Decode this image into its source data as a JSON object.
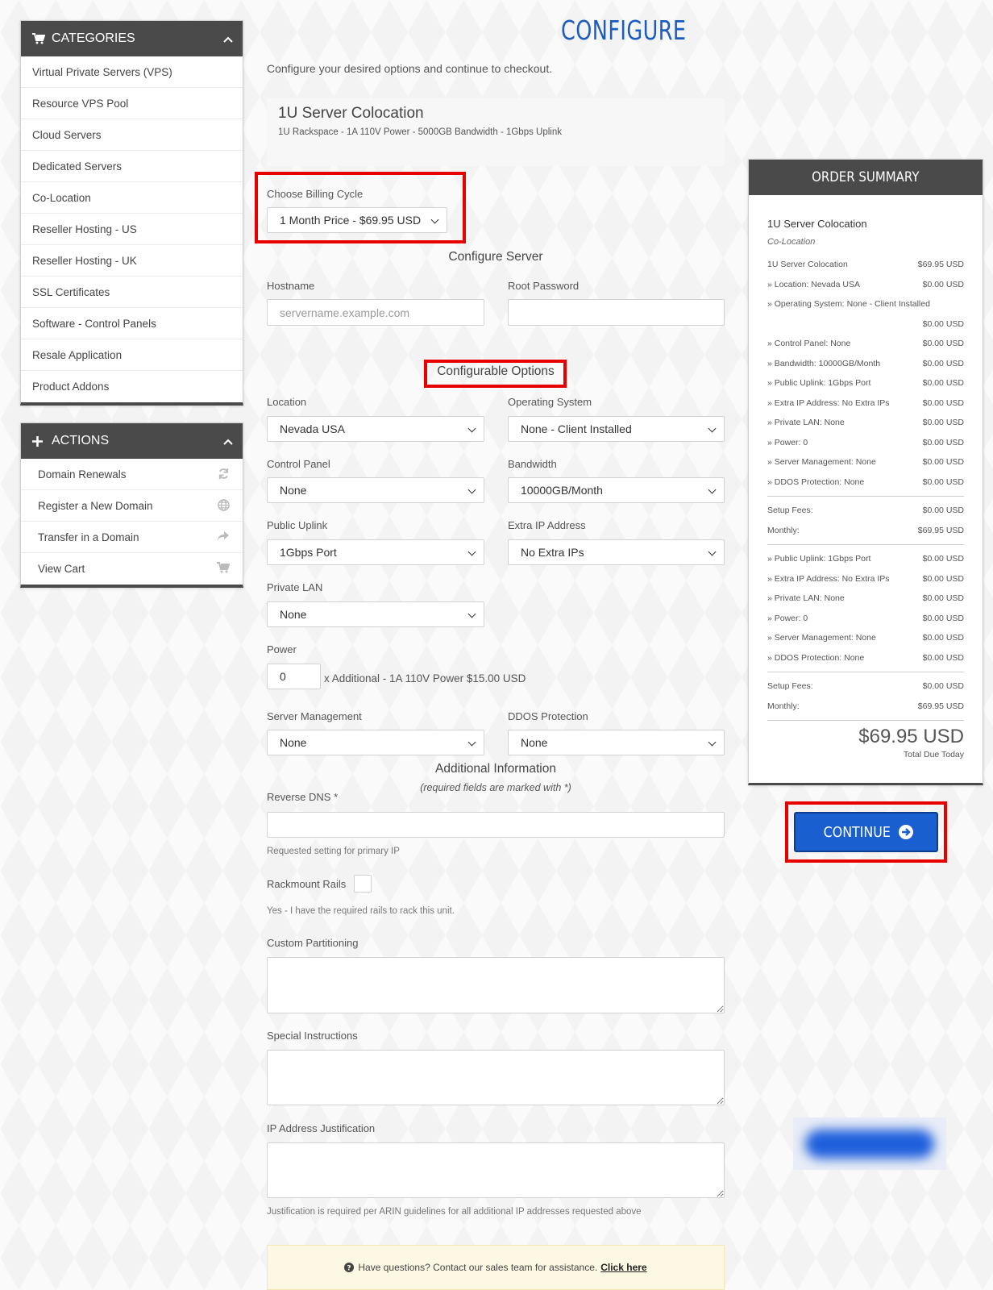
{
  "sidebar": {
    "categories_title": "CATEGORIES",
    "categories": [
      "Virtual Private Servers (VPS)",
      "Resource VPS Pool",
      "Cloud Servers",
      "Dedicated Servers",
      "Co-Location",
      "Reseller Hosting - US",
      "Reseller Hosting - UK",
      "SSL Certificates",
      "Software - Control Panels",
      "Resale Application",
      "Product Addons"
    ],
    "actions_title": "ACTIONS",
    "actions": [
      {
        "label": "Domain Renewals",
        "icon": "refresh-icon"
      },
      {
        "label": "Register a New Domain",
        "icon": "globe-icon"
      },
      {
        "label": "Transfer in a Domain",
        "icon": "share-icon"
      },
      {
        "label": "View Cart",
        "icon": "cart-icon"
      }
    ]
  },
  "main": {
    "title": "CONFIGURE",
    "intro": "Configure your desired options and continue to checkout.",
    "product": {
      "name": "1U Server Colocation",
      "description": "1U Rackspace - 1A 110V Power - 5000GB Bandwidth - 1Gbps Uplink"
    },
    "billing": {
      "label": "Choose Billing Cycle",
      "value": "1 Month Price - $69.95 USD"
    },
    "configure_server": {
      "title": "Configure Server",
      "hostname_label": "Hostname",
      "hostname_placeholder": "servername.example.com",
      "root_password_label": "Root Password"
    },
    "options": {
      "title": "Configurable Options",
      "location_label": "Location",
      "location_value": "Nevada USA",
      "os_label": "Operating System",
      "os_value": "None - Client Installed",
      "control_panel_label": "Control Panel",
      "control_panel_value": "None",
      "bandwidth_label": "Bandwidth",
      "bandwidth_value": "10000GB/Month",
      "uplink_label": "Public Uplink",
      "uplink_value": "1Gbps Port",
      "extra_ip_label": "Extra IP Address",
      "extra_ip_value": "No Extra IPs",
      "private_lan_label": "Private LAN",
      "private_lan_value": "None",
      "power_label": "Power",
      "power_value": "0",
      "power_suffix": "x Additional - 1A 110V Power $15.00 USD",
      "server_mgmt_label": "Server Management",
      "server_mgmt_value": "None",
      "ddos_label": "DDOS Protection",
      "ddos_value": "None"
    },
    "additional": {
      "title": "Additional Information",
      "subtitle": "(required fields are marked with *)",
      "rdns_label": "Reverse DNS *",
      "rdns_help": "Requested setting for primary IP",
      "rails_label": "Rackmount Rails",
      "rails_help": "Yes - I have the required rails to rack this unit.",
      "partitioning_label": "Custom Partitioning",
      "special_label": "Special Instructions",
      "ip_just_label": "IP Address Justification",
      "ip_just_help": "Justification is required per ARIN guidelines for all additional IP addresses requested above"
    },
    "contact": {
      "text": "Have questions? Contact our sales team for assistance.",
      "link": "Click here"
    }
  },
  "summary": {
    "title": "ORDER SUMMARY",
    "product": "1U Server Colocation",
    "category": "Co-Location",
    "rows": [
      [
        "1U Server Colocation",
        "$69.95 USD"
      ],
      [
        "» Location: Nevada USA",
        "$0.00 USD"
      ],
      [
        "» Operating System: None - Client Installed",
        ""
      ],
      [
        "",
        "$0.00 USD"
      ],
      [
        "» Control Panel: None",
        "$0.00 USD"
      ],
      [
        "» Bandwidth: 10000GB/Month",
        "$0.00 USD"
      ],
      [
        "» Public Uplink: 1Gbps Port",
        "$0.00 USD"
      ],
      [
        "» Extra IP Address: No Extra IPs",
        "$0.00 USD"
      ],
      [
        "» Private LAN: None",
        "$0.00 USD"
      ],
      [
        "» Power: 0",
        "$0.00 USD"
      ],
      [
        "» Server Management: None",
        "$0.00 USD"
      ],
      [
        "» DDOS Protection: None",
        "$0.00 USD"
      ]
    ],
    "totals1": [
      [
        "Setup Fees:",
        "$0.00 USD"
      ],
      [
        "Monthly:",
        "$69.95 USD"
      ]
    ],
    "rows2": [
      [
        "» Public Uplink: 1Gbps Port",
        "$0.00 USD"
      ],
      [
        "» Extra IP Address: No Extra IPs",
        "$0.00 USD"
      ],
      [
        "» Private LAN: None",
        "$0.00 USD"
      ],
      [
        "» Power: 0",
        "$0.00 USD"
      ],
      [
        "» Server Management: None",
        "$0.00 USD"
      ],
      [
        "» DDOS Protection: None",
        "$0.00 USD"
      ]
    ],
    "totals2": [
      [
        "Setup Fees:",
        "$0.00 USD"
      ],
      [
        "Monthly:",
        "$69.95 USD"
      ]
    ],
    "total": "$69.95 USD",
    "total_label": "Total Due Today",
    "continue_label": "CONTINUE"
  },
  "colors": {
    "accent": "#1c5cbc",
    "button": "#1a5fcf",
    "highlight": "#e60000",
    "panel_header": "#4a4a4a"
  }
}
